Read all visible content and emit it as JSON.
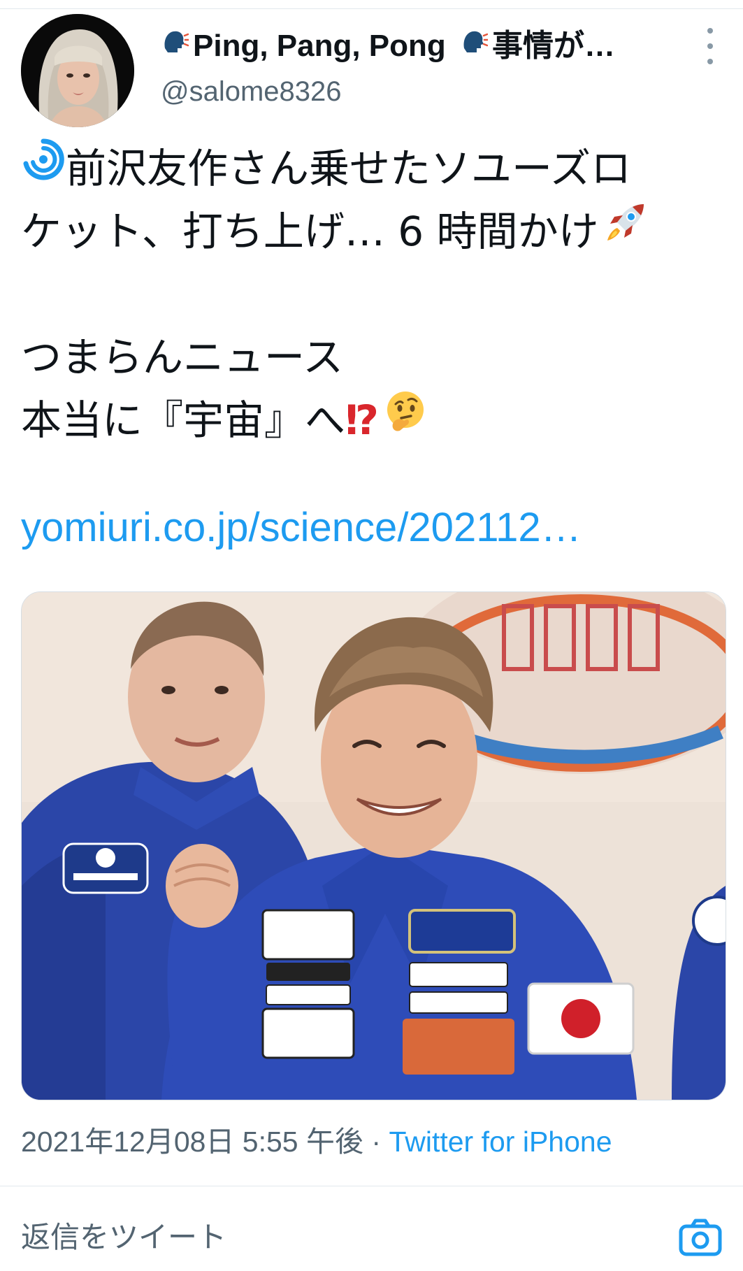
{
  "tweet": {
    "author": {
      "display_name_parts": [
        "Ping, Pang, Pong",
        "事情が…"
      ],
      "handle": "@salome8326",
      "avatar": "avatar-photo"
    },
    "text_lines": [
      "前沢友作さん乗せたソユーズロ",
      "ケット、打ち上げ… 6 時間かけ",
      "つまらんニュース",
      "本当に『宇宙』へ"
    ],
    "emoji": {
      "speaking_head": "speaking-head-icon",
      "cyclone": "cyclone-icon",
      "rocket": "rocket-icon",
      "exclamation_question": "⁉",
      "thinking": "thinking-face-icon"
    },
    "link_text": "yomiuri.co.jp/science/202112…",
    "media": {
      "image": "photo-of-astronauts"
    },
    "timestamp": "2021年12月08日 5:55 午後",
    "separator": "·",
    "source": "Twitter for iPhone"
  },
  "reply": {
    "placeholder": "返信をツイート",
    "camera_icon": "camera-icon"
  },
  "colors": {
    "link": "#1d9bf0",
    "secondary": "#536471",
    "text": "#0f1419",
    "divider": "#e1e8ed"
  }
}
